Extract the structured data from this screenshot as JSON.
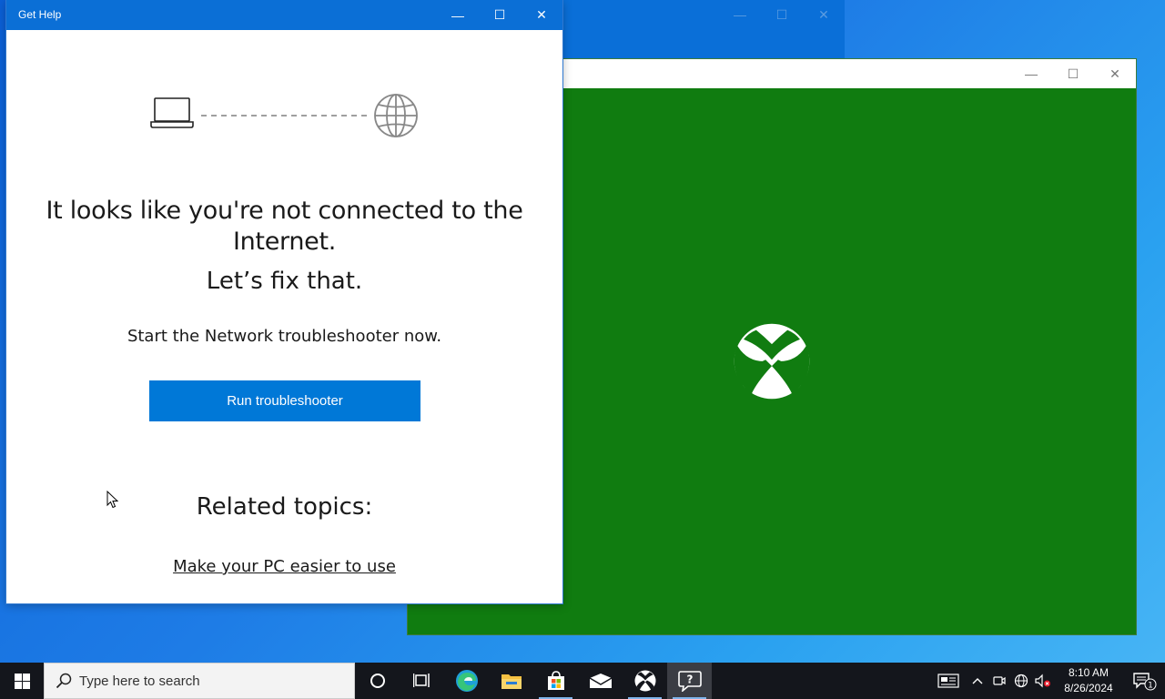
{
  "background_window": {
    "controls": {
      "minimize": "—",
      "maximize": "☐",
      "close": "✕"
    }
  },
  "xbox_window": {
    "accent": "#107c10",
    "controls": {
      "minimize": "—",
      "maximize": "☐",
      "close": "✕"
    }
  },
  "help_window": {
    "title": "Get Help",
    "accent": "#0078d7",
    "controls": {
      "minimize": "—",
      "maximize": "☐",
      "close": "✕"
    },
    "headline": "It looks like you're not connected to the Internet.",
    "subhead": "Let’s fix that.",
    "instruction": "Start the Network troubleshooter now.",
    "run_button": "Run troubleshooter",
    "related_heading": "Related topics:",
    "related_links": [
      "Make your PC easier to use"
    ]
  },
  "taskbar": {
    "search_placeholder": "Type here to search",
    "apps": [
      "cortana-icon",
      "task-view-icon",
      "edge-icon",
      "file-explorer-icon",
      "store-icon",
      "mail-icon",
      "xbox-icon",
      "get-help-icon"
    ],
    "clock_time": "8:10 AM",
    "clock_date": "8/26/2024",
    "notification_count": "1"
  }
}
